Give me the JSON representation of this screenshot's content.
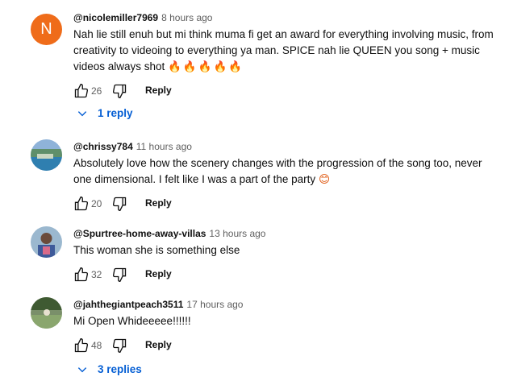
{
  "comments": [
    {
      "author": "@nicolemiller7969",
      "time": "8 hours ago",
      "avatar_letter": "N",
      "text": "Nah lie still enuh but mi think muma fi get an award for everything involving music, from creativity to videoing to everything ya man. SPICE nah lie QUEEN you song + music videos always shot",
      "emoji": "🔥🔥🔥🔥🔥",
      "likes": "26",
      "reply_label": "Reply",
      "replies_label": "1 reply"
    },
    {
      "author": "@chrissy784",
      "time": "11 hours ago",
      "text": "Absolutely love how the scenery changes with the progression of the song too, never one dimensional. I felt like I was a part of the party",
      "emoji": "😊",
      "likes": "20",
      "reply_label": "Reply"
    },
    {
      "author": "@Spurtree-home-away-villas",
      "time": "13 hours ago",
      "text": "This woman she is something else",
      "likes": "32",
      "reply_label": "Reply"
    },
    {
      "author": "@jahthegiantpeach3511",
      "time": "17 hours ago",
      "text": "Mi Open Whideeeee!!!!!!",
      "likes": "48",
      "reply_label": "Reply",
      "replies_label": "3 replies"
    }
  ],
  "colors": {
    "link": "#065fd4",
    "avatar_n": "#ef6c1a",
    "muted": "#606060"
  },
  "icons": {
    "like": "thumbs-up-icon",
    "dislike": "thumbs-down-icon",
    "expand": "chevron-down-icon"
  }
}
